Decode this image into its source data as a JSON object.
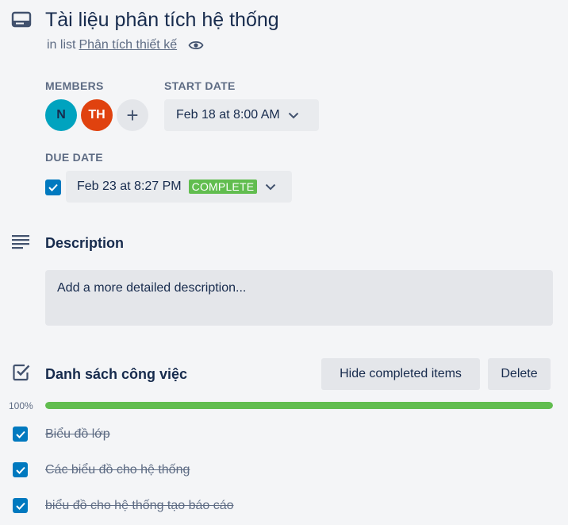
{
  "card": {
    "title": "Tài liệu phân tích hệ thống",
    "list_prefix": "in list",
    "list_name": "Phân tích thiết kế"
  },
  "members": {
    "label": "MEMBERS",
    "avatars": [
      {
        "initials": "N",
        "color": "#00a3bf"
      },
      {
        "initials": "TH",
        "color": "#e0420f"
      }
    ],
    "add_symbol": "+"
  },
  "start_date": {
    "label": "START DATE",
    "value": "Feb 18 at 8:00 AM"
  },
  "due_date": {
    "label": "DUE DATE",
    "checked": true,
    "value": "Feb 23 at 8:27 PM",
    "status": "COMPLETE"
  },
  "description": {
    "title": "Description",
    "placeholder": "Add a more detailed description..."
  },
  "checklist": {
    "title": "Danh sách công việc",
    "hide_label": "Hide completed items",
    "delete_label": "Delete",
    "progress_label": "100%",
    "progress": 1.0,
    "items": [
      {
        "text": "Biểu đồ lớp",
        "checked": true
      },
      {
        "text": "Các biểu đồ cho hệ thống",
        "checked": true
      },
      {
        "text": "biểu đồ cho hệ thống tạo báo cáo",
        "checked": true
      }
    ]
  },
  "colors": {
    "accent": "#0079bf",
    "success": "#61bd4f",
    "text": "#172b4d",
    "muted": "#5e6c84"
  },
  "icons": {
    "card": "card-icon",
    "description": "description-lines-icon",
    "checklist": "checklist-icon",
    "watch": "eye-icon",
    "dropdown": "chevron-down-icon"
  }
}
